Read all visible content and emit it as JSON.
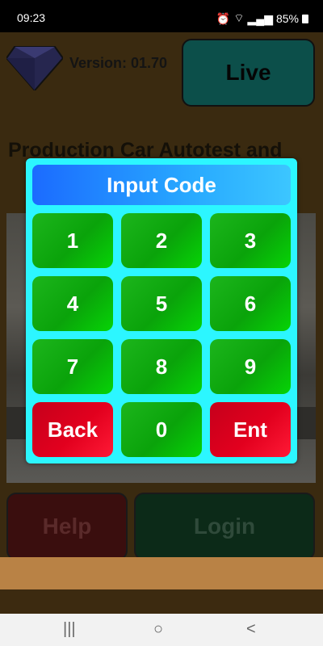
{
  "status": {
    "time": "09:23",
    "battery": "85%"
  },
  "app": {
    "version": "Version: 01.70",
    "live_label": "Live",
    "headline": "Production Car Autotest and",
    "help_label": "Help",
    "login_label": "Login"
  },
  "modal": {
    "title": "Input Code",
    "keys": [
      "1",
      "2",
      "3",
      "4",
      "5",
      "6",
      "7",
      "8",
      "9",
      "Back",
      "0",
      "Ent"
    ]
  },
  "nav": {
    "recent": "|||",
    "home": "○",
    "back": "<"
  }
}
